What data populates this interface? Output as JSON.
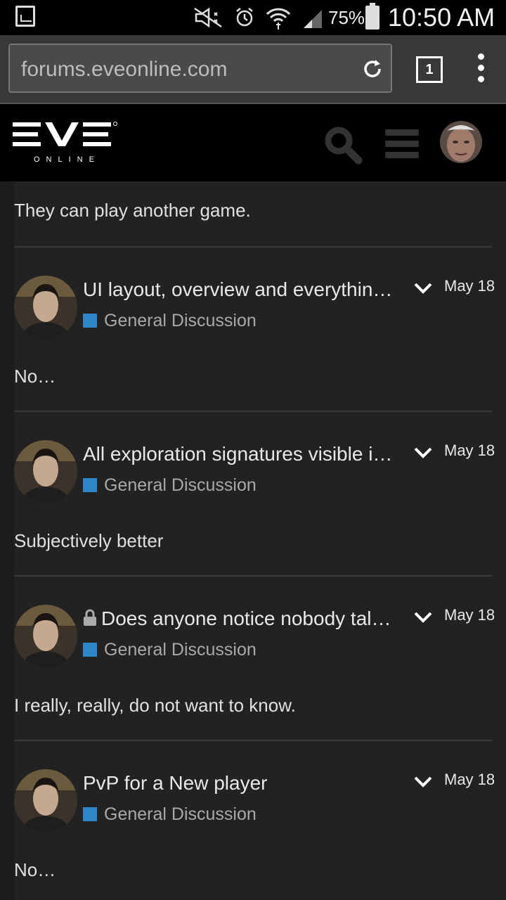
{
  "status_bar": {
    "battery": "75%",
    "time": "10:50 AM",
    "icons": [
      "gallery-icon",
      "mute-icon",
      "alarm-icon",
      "wifi-icon",
      "signal-icon",
      "battery-icon"
    ]
  },
  "browser": {
    "url": "forums.eveonline.com",
    "tab_count": "1"
  },
  "site": {
    "logo_main": "EVE",
    "logo_sub": "ONLINE"
  },
  "feed": {
    "top_excerpt": "They can play another game.",
    "posts": [
      {
        "title": "UI layout, overview and everythin…",
        "category": "General Discussion",
        "date": "May 18",
        "excerpt": "No…",
        "locked": false
      },
      {
        "title": "All exploration signatures visible i…",
        "category": "General Discussion",
        "date": "May 18",
        "excerpt": "Subjectively better",
        "locked": false
      },
      {
        "title": "Does anyone notice nobody tal…",
        "category": "General Discussion",
        "date": "May 18",
        "excerpt": "I really, really, do not want to know.",
        "locked": true
      },
      {
        "title": "PvP for a New player",
        "category": "General Discussion",
        "date": "May 18",
        "excerpt": "No…",
        "locked": false
      }
    ],
    "category_color": "#2e86c9"
  }
}
